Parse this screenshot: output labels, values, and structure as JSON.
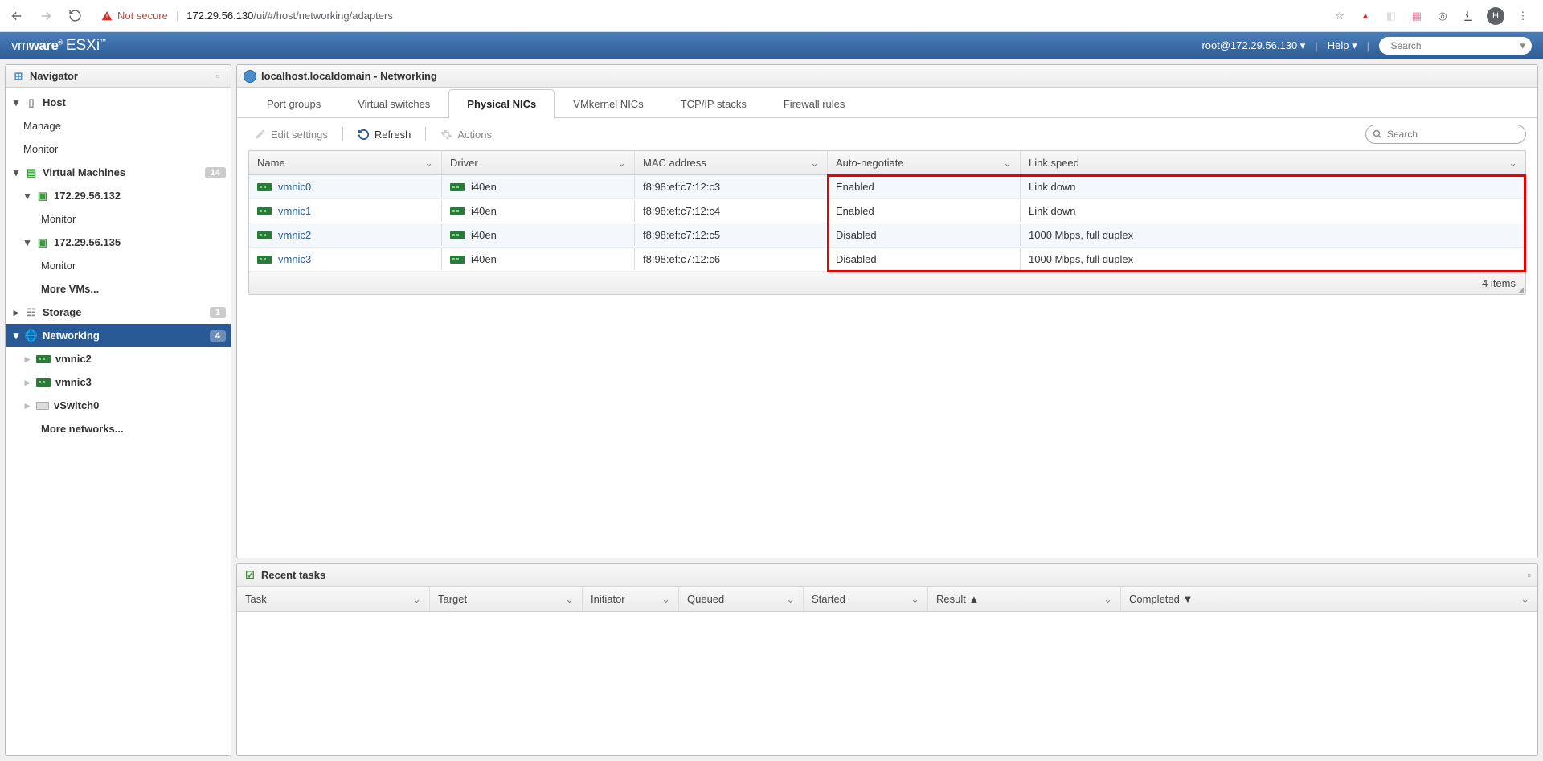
{
  "browser": {
    "not_secure": "Not secure",
    "url_host": "172.29.56.130",
    "url_path": "/ui/#/host/networking/adapters",
    "avatar_letter": "H"
  },
  "topbar": {
    "brand_a": "vm",
    "brand_b": "ware",
    "brand_c": "ESXi",
    "user": "root@172.29.56.130",
    "help": "Help",
    "search_placeholder": "Search"
  },
  "navigator": {
    "title": "Navigator",
    "host": "Host",
    "manage": "Manage",
    "monitor": "Monitor",
    "vms_label": "Virtual Machines",
    "vms_count": "14",
    "vm1": "172.29.56.132",
    "vm1_monitor": "Monitor",
    "vm2": "172.29.56.135",
    "vm2_monitor": "Monitor",
    "more_vms": "More VMs...",
    "storage": "Storage",
    "storage_count": "1",
    "networking": "Networking",
    "networking_count": "4",
    "nic2": "vmnic2",
    "nic3": "vmnic3",
    "vswitch0": "vSwitch0",
    "more_nets": "More networks..."
  },
  "content": {
    "title": "localhost.localdomain - Networking",
    "tabs": {
      "port_groups": "Port groups",
      "virtual_switches": "Virtual switches",
      "physical_nics": "Physical NICs",
      "vmkernel_nics": "VMkernel NICs",
      "tcpip_stacks": "TCP/IP stacks",
      "firewall_rules": "Firewall rules"
    },
    "toolbar": {
      "edit": "Edit settings",
      "refresh": "Refresh",
      "actions": "Actions",
      "search_ph": "Search"
    },
    "grid": {
      "headers": {
        "name": "Name",
        "driver": "Driver",
        "mac": "MAC address",
        "auto": "Auto-negotiate",
        "speed": "Link speed"
      },
      "rows": [
        {
          "name": "vmnic0",
          "driver": "i40en",
          "mac": "f8:98:ef:c7:12:c3",
          "auto": "Enabled",
          "speed": "Link down"
        },
        {
          "name": "vmnic1",
          "driver": "i40en",
          "mac": "f8:98:ef:c7:12:c4",
          "auto": "Enabled",
          "speed": "Link down"
        },
        {
          "name": "vmnic2",
          "driver": "i40en",
          "mac": "f8:98:ef:c7:12:c5",
          "auto": "Disabled",
          "speed": "1000 Mbps, full duplex"
        },
        {
          "name": "vmnic3",
          "driver": "i40en",
          "mac": "f8:98:ef:c7:12:c6",
          "auto": "Disabled",
          "speed": "1000 Mbps, full duplex"
        }
      ],
      "footer": "4 items"
    }
  },
  "tasks": {
    "title": "Recent tasks",
    "headers": {
      "task": "Task",
      "target": "Target",
      "initiator": "Initiator",
      "queued": "Queued",
      "started": "Started",
      "result": "Result ▲",
      "completed": "Completed ▼"
    }
  }
}
